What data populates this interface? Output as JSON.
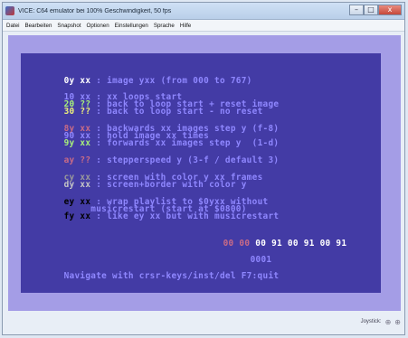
{
  "window": {
    "title": "VICE: C64 emulator bei 100% Geschwindigkeit, 50 fps",
    "buttons": [
      "–",
      "□",
      "x"
    ]
  },
  "menubar": {
    "items": [
      "Datei",
      "Bearbeiten",
      "Snapshot",
      "Optionen",
      "Einstellungen",
      "Sprache",
      "Hilfe"
    ]
  },
  "colors": {
    "border": "#a49de6",
    "screen": "#433ba5",
    "white": "#ffffff",
    "light_blue": "#8f87ff",
    "light_green": "#a8f07a",
    "yellow": "#eef07a",
    "pink": "#c96b86",
    "grey": "#9a9a9a",
    "light_grey": "#c6c6c6",
    "black": "#000000",
    "purple_dim": "#7f72d8"
  },
  "c64": {
    "lines": [
      {
        "key": "0y xx",
        "text": " : image yxx (from 000 to 767)",
        "keycolor": "#ffffff"
      },
      {
        "key": "10 xx",
        "text": " : xx loops start",
        "keycolor": "#8f87ff"
      },
      {
        "key": "20 ??",
        "text": " : back to loop start + reset image",
        "keycolor": "#a8f07a"
      },
      {
        "key": "30 ??",
        "text": " : back to loop start - no reset",
        "keycolor": "#eef07a"
      },
      {
        "key": "8y xx",
        "text": " : backwards xx images step y (f-8)",
        "keycolor": "#c96b86"
      },
      {
        "key": "90 xx",
        "text": " : hold image xx times",
        "keycolor": "#8f87ff"
      },
      {
        "key": "9y xx",
        "text": " : forwards xx images step y  (1-d)",
        "keycolor": "#a8f07a"
      },
      {
        "key": "ay ??",
        "text": " : stepperspeed y (3-f / default 3)",
        "keycolor": "#c96b86"
      },
      {
        "key": "cy xx",
        "text": " : screen with color y xx frames",
        "keycolor": "#9a9a9a"
      },
      {
        "key": "dy xx",
        "text": " : screen+border with color y",
        "keycolor": "#c6c6c6"
      },
      {
        "key": "ey xx",
        "text": " : wrap playlist to $0yxx without",
        "keycolor": "#000000"
      },
      {
        "key": "",
        "text": "     musicrestart (start at $0800)",
        "keycolor": "#ffffff"
      },
      {
        "key": "fy xx",
        "text": " : like ey xx but with musicrestart",
        "keycolor": "#000000"
      }
    ],
    "cursor_cells": "00 00",
    "sequence": "00 91 00 91 00 91",
    "counter": "0001",
    "footer": "Navigate with crsr-keys/inst/del F7:quit"
  },
  "status": {
    "label": "Joystick:"
  }
}
